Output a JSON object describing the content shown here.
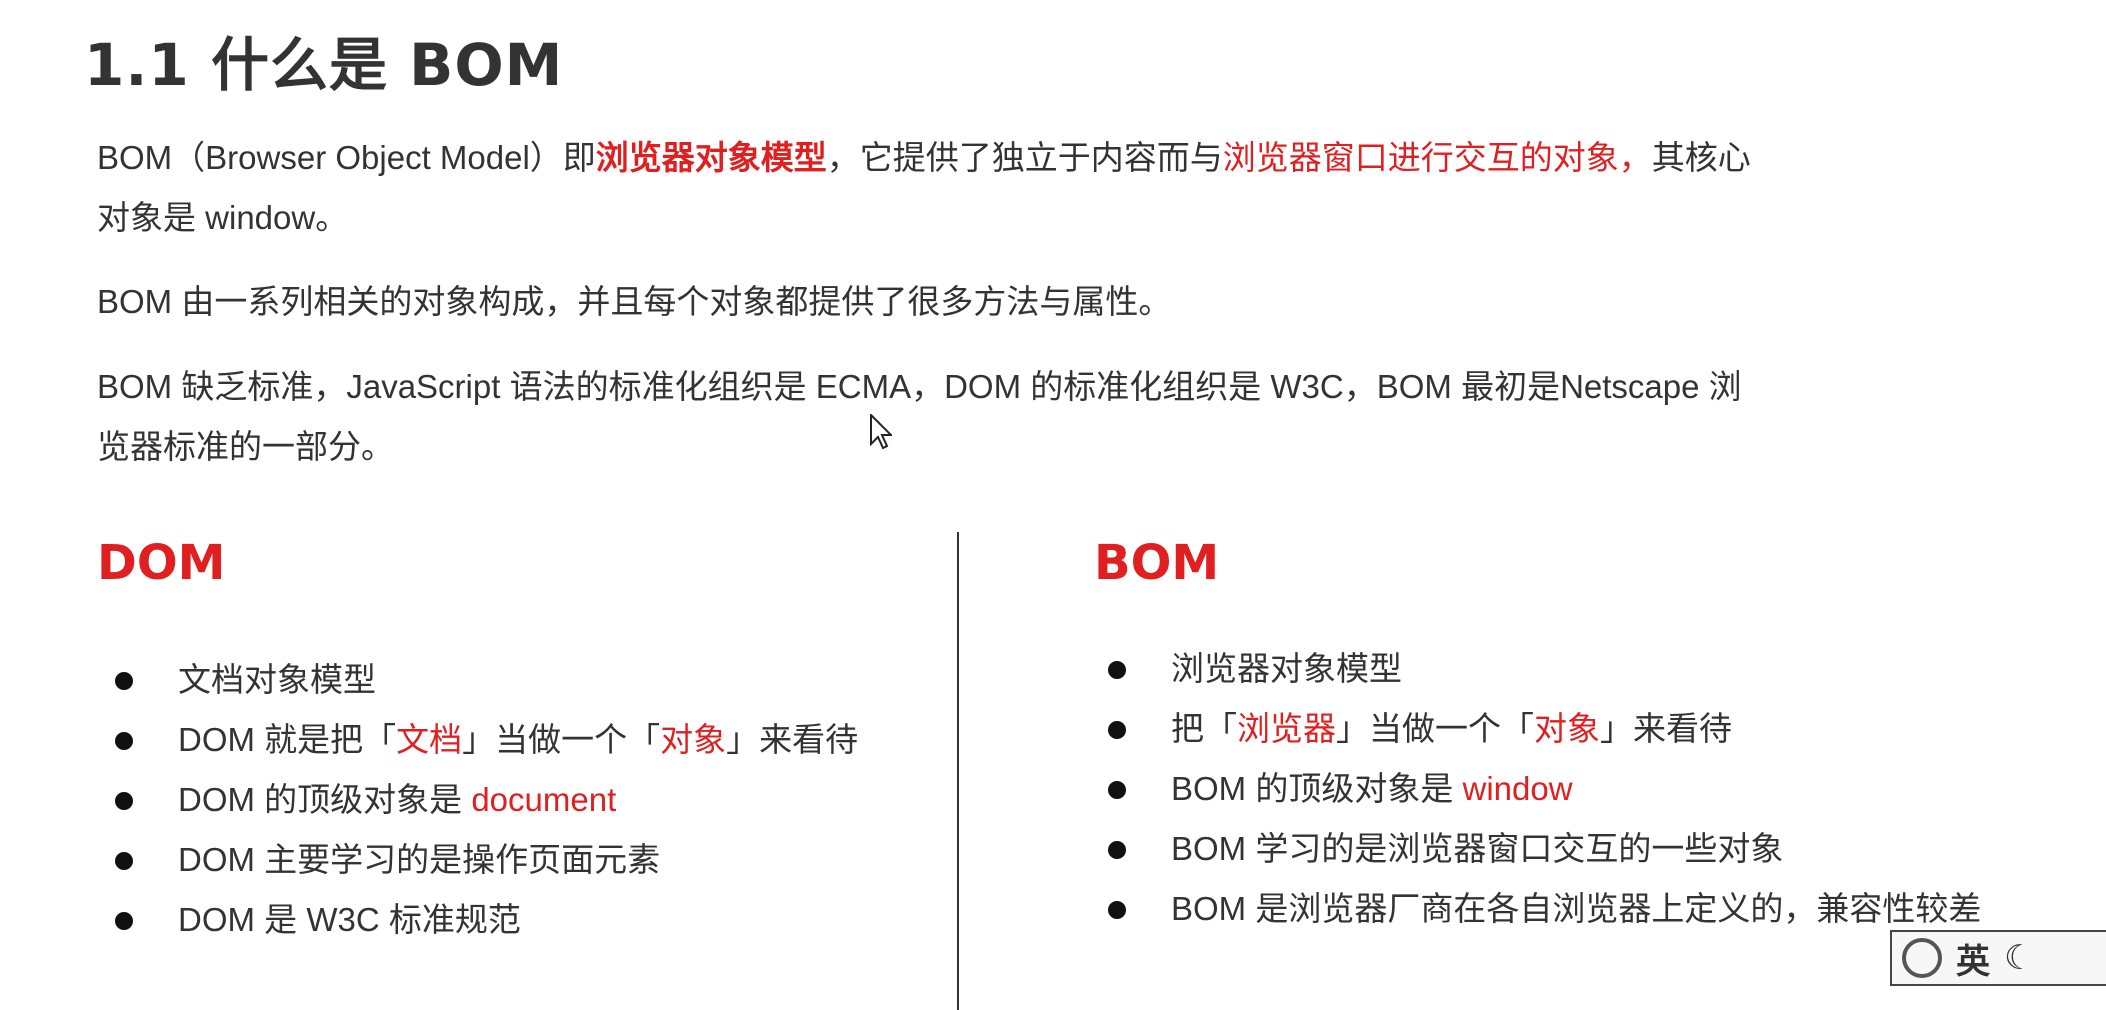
{
  "heading": "1.1 什么是 BOM",
  "para1": {
    "t1": "BOM（Browser Object Model）即",
    "t2": "浏览器对象模型",
    "t3": "，它提供了独立于内容而与",
    "t4": "浏览器窗口进行交互的对象，",
    "t5": "其核心",
    "line2": "对象是 window。"
  },
  "para2": "BOM 由一系列相关的对象构成，并且每个对象都提供了很多方法与属性。",
  "para3": {
    "line1": "BOM 缺乏标准，JavaScript 语法的标准化组织是 ECMA，DOM 的标准化组织是 W3C，BOM 最初是Netscape 浏",
    "line2": "览器标准的一部分。"
  },
  "dom": {
    "title": "DOM",
    "items": [
      {
        "text": "文档对象模型"
      },
      {
        "a": "DOM 就是把「",
        "b": "文档",
        "c": "」当做一个「",
        "d": "对象",
        "e": "」来看待"
      },
      {
        "a": "DOM 的顶级对象是 ",
        "b": "document"
      },
      {
        "text": "DOM 主要学习的是操作页面元素"
      },
      {
        "text": "DOM 是 W3C 标准规范"
      }
    ]
  },
  "bom": {
    "title": "BOM",
    "items": [
      {
        "text": "浏览器对象模型"
      },
      {
        "a": "把「",
        "b": "浏览器",
        "c": "」当做一个「",
        "d": "对象",
        "e": "」来看待"
      },
      {
        "a": "BOM 的顶级对象是 ",
        "b": "window"
      },
      {
        "text": "BOM 学习的是浏览器窗口交互的一些对象"
      },
      {
        "text": "BOM 是浏览器厂商在各自浏览器上定义的，兼容性较差"
      }
    ]
  },
  "ime": {
    "lang": "英"
  },
  "colors": {
    "accent": "#e02020",
    "text": "#333333"
  }
}
